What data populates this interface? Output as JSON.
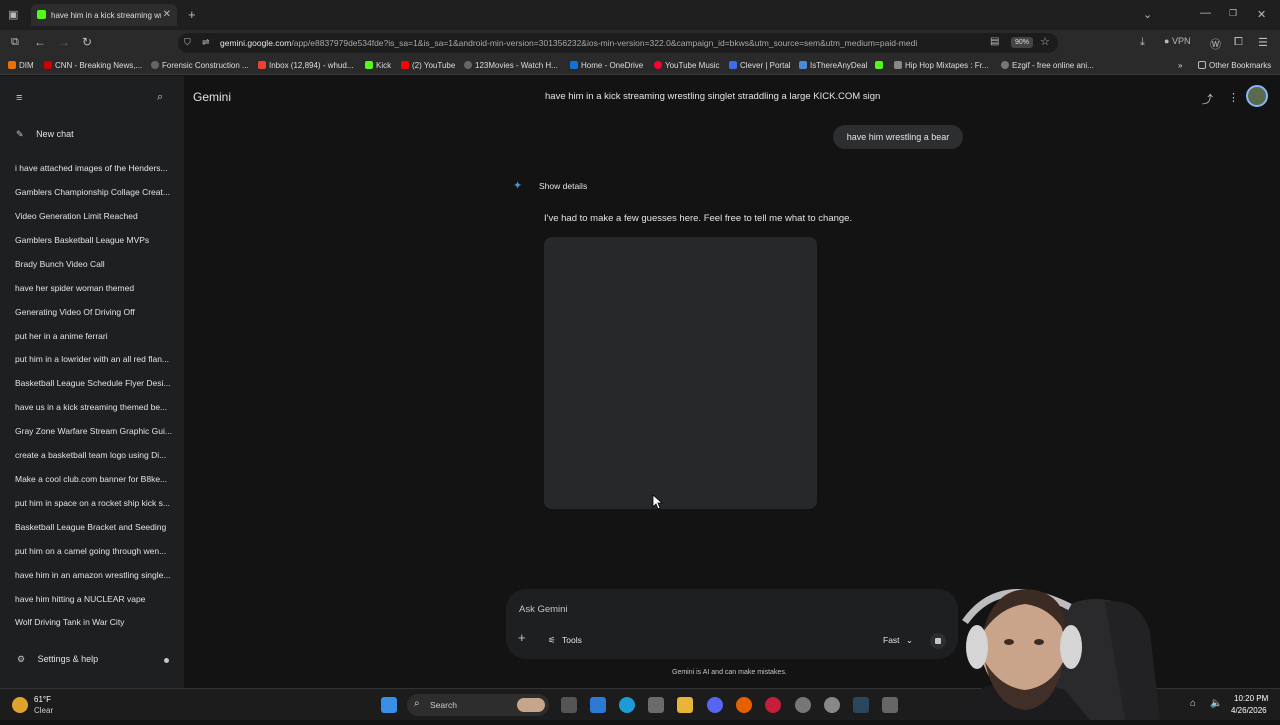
{
  "browser": {
    "tab_title": "have him in a kick streaming wr",
    "url_prefix": "gemini.google.com",
    "url_rest": "/app/e8837979de534fde?is_sa=1&is_sa=1&android-min-version=301356232&ios-min-version=322.0&campaign_id=bkws&utm_source=sem&utm_medium=paid-medi",
    "zoom": "90%",
    "vpn": "VPN",
    "bookmarks": [
      "DIM",
      "CNN - Breaking News,...",
      "Forensic Construction ...",
      "Inbox (12,894) - whud...",
      "Kick",
      "(2) YouTube",
      "123Movies - Watch H...",
      "Home - OneDrive",
      "YouTube Music",
      "Clever | Portal",
      "IsThereAnyDeal",
      "Hip Hop Mixtapes : Fr...",
      "Ezgif - free online ani..."
    ],
    "other_bookmarks": "Other Bookmarks"
  },
  "sidebar": {
    "app_name": "Gemini",
    "new_chat": "New chat",
    "items": [
      "i have attached images of the Henders...",
      "Gamblers Championship Collage Creat...",
      "Video Generation Limit Reached",
      "Gamblers Basketball League MVPs",
      "Brady Bunch Video Call",
      "have her spider woman themed",
      "Generating Video Of Driving Off",
      "put her in a anime ferrari",
      "put him in a lowrider with an all red flan...",
      "Basketball League Schedule Flyer Desi...",
      "have us in a kick streaming themed be...",
      "Gray Zone Warfare Stream Graphic Gui...",
      "create a basketball team logo using Di...",
      "Make a cool club.com banner for B8ke...",
      "put him in space on a rocket ship kick s...",
      "Basketball League Bracket and Seeding",
      "put him on a camel going through wen...",
      "have him in an amazon wrestling single...",
      "have him hitting a NUCLEAR vape",
      "Wolf Driving Tank in War City"
    ],
    "settings": "Settings & help"
  },
  "main": {
    "conversation_title": "have him in a kick streaming wrestling singlet straddling a large KICK.COM sign",
    "user_message": "have him wrestling a bear",
    "show_details": "Show details",
    "response": "I've had to make a few guesses here. Feel free to tell me what to change.",
    "input_placeholder": "Ask Gemini",
    "tools": "Tools",
    "mode": "Fast",
    "disclaimer": "Gemini is AI and can make mistakes."
  },
  "taskbar": {
    "weather_temp": "61°F",
    "weather_desc": "Clear",
    "search": "Search",
    "time": "10:20 PM",
    "date": "4/26/2026"
  },
  "colors": {
    "background": "#131314",
    "sidebar": "#1e1f20",
    "bubble": "#2d2e30",
    "kick_green": "#53fc18"
  }
}
